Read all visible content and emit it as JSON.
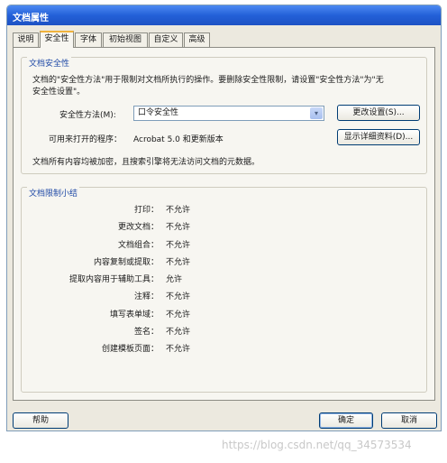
{
  "window": {
    "title": "文档属性"
  },
  "tabs": [
    {
      "label": "说明"
    },
    {
      "label": "安全性"
    },
    {
      "label": "字体"
    },
    {
      "label": "初始视图"
    },
    {
      "label": "自定义"
    },
    {
      "label": "高级"
    }
  ],
  "security": {
    "group_title": "文档安全性",
    "description_line1": "文档的\"安全性方法\"用于限制对文档所执行的操作。要删除安全性限制，请设置\"安全性方法\"为\"无",
    "description_line2": "安全性设置\"。",
    "method_label": "安全性方法(M):",
    "method_value": "口令安全性",
    "change_button": "更改设置(S)...",
    "compat_label": "可用来打开的程序：",
    "compat_value": "Acrobat 5.0 和更新版本",
    "details_button": "显示详细资料(D)...",
    "encryption_note": "文档所有内容均被加密，且搜索引擎将无法访问文档的元数据。"
  },
  "summary": {
    "group_title": "文档限制小结",
    "rows": [
      {
        "label": "打印：",
        "value": "不允许"
      },
      {
        "label": "更改文档：",
        "value": "不允许"
      },
      {
        "label": "文档组合：",
        "value": "不允许"
      },
      {
        "label": "内容复制或提取：",
        "value": "不允许"
      },
      {
        "label": "提取内容用于辅助工具：",
        "value": "允许"
      },
      {
        "label": "注释：",
        "value": "不允许"
      },
      {
        "label": "填写表单域：",
        "value": "不允许"
      },
      {
        "label": "签名：",
        "value": "不允许"
      },
      {
        "label": "创建模板页面：",
        "value": "不允许"
      }
    ]
  },
  "footer": {
    "help_button": "帮助",
    "ok_button": "确定",
    "cancel_button": "取消"
  },
  "watermark": "https://blog.csdn.net/qq_34573534",
  "colors": {
    "accent": "#2360d8",
    "group_title": "#1f49a6",
    "tab_highlight": "#f0b33c"
  }
}
